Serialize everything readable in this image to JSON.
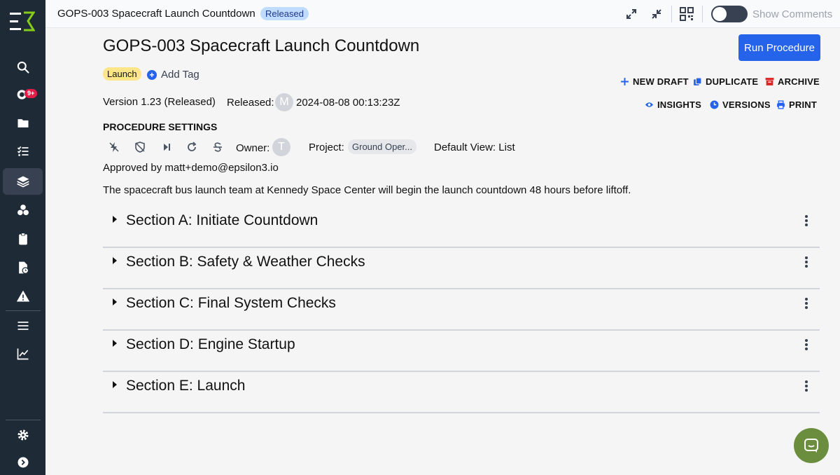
{
  "topbar": {
    "title": "GOPS-003 Spacecraft Launch Countdown",
    "status": "Released",
    "show_comments_label": "Show Comments"
  },
  "sidebar": {
    "notification_count": "9+",
    "items": [
      "search",
      "notifications",
      "folders",
      "checklist",
      "procedures",
      "dependencies",
      "clipboard",
      "reports",
      "alerts",
      "list",
      "analytics",
      "settings",
      "expand"
    ]
  },
  "procedure": {
    "title": "GOPS-003 Spacecraft Launch Countdown",
    "run_label": "Run Procedure",
    "tag": "Launch",
    "add_tag_label": "Add Tag",
    "version": "Version 1.23 (Released)",
    "released_label": "Released:",
    "released_avatar": "M",
    "released_date": "2024-08-08 00:13:23Z",
    "actions": {
      "new_draft": "NEW DRAFT",
      "duplicate": "DUPLICATE",
      "archive": "ARCHIVE",
      "insights": "INSIGHTS",
      "versions": "VERSIONS",
      "print": "PRINT"
    },
    "settings_title": "PROCEDURE SETTINGS",
    "owner_label": "Owner:",
    "owner_avatar": "T",
    "project_label": "Project:",
    "project_value": "Ground Oper...",
    "default_view_label": "Default View:",
    "default_view_value": "List",
    "approved_by": "Approved by matt+demo@epsilon3.io",
    "description": "The spacecraft bus launch team at Kennedy Space Center will begin the launch countdown 48 hours before liftoff."
  },
  "sections": [
    {
      "title": "Section A: Initiate Countdown"
    },
    {
      "title": "Section B: Safety & Weather Checks"
    },
    {
      "title": "Section C: Final System Checks"
    },
    {
      "title": "Section D: Engine Startup"
    },
    {
      "title": "Section E: Launch"
    }
  ],
  "colors": {
    "sidebar_bg": "#1f2a37",
    "primary": "#2563eb",
    "tag_yellow": "#fde68a",
    "status_blue": "#bfdbfe",
    "chat_green": "#6b8e3e",
    "archive_red": "#dc2626",
    "logo_green": "#84cc16"
  }
}
